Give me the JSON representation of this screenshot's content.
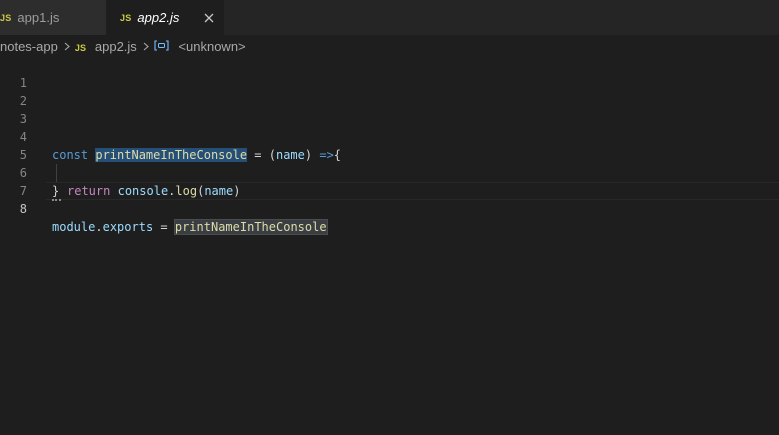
{
  "tabs": [
    {
      "badge": "JS",
      "label": "app1.js"
    },
    {
      "badge": "JS",
      "label": "app2.js"
    }
  ],
  "breadcrumb": {
    "folder": "notes-app",
    "file_badge": "JS",
    "file": "app2.js",
    "symbol": "<unknown>"
  },
  "editor": {
    "line_numbers": [
      "1",
      "2",
      "3",
      "4",
      "5",
      "6",
      "7",
      "8"
    ],
    "line4": {
      "kw": "const",
      "name": "printNameInTheConsole",
      "eq": " = (",
      "param": "name",
      "close": ") ",
      "arrow": "=>",
      "brace": "{"
    },
    "line5": {
      "kw": "return",
      "obj": "console",
      "dot": ".",
      "fn": "log",
      "open": "(",
      "arg": "name",
      "close": ")"
    },
    "line6": {
      "brace": "}"
    },
    "line8": {
      "obj": "module",
      "dot": ".",
      "prop": "exports",
      "eq": " = ",
      "value": "printNameInTheConsole"
    }
  },
  "colors": {
    "js_badge": "#cbcb41",
    "keyword": "#569cd6",
    "function": "#dcdcaa",
    "variable": "#9cdcfe"
  }
}
